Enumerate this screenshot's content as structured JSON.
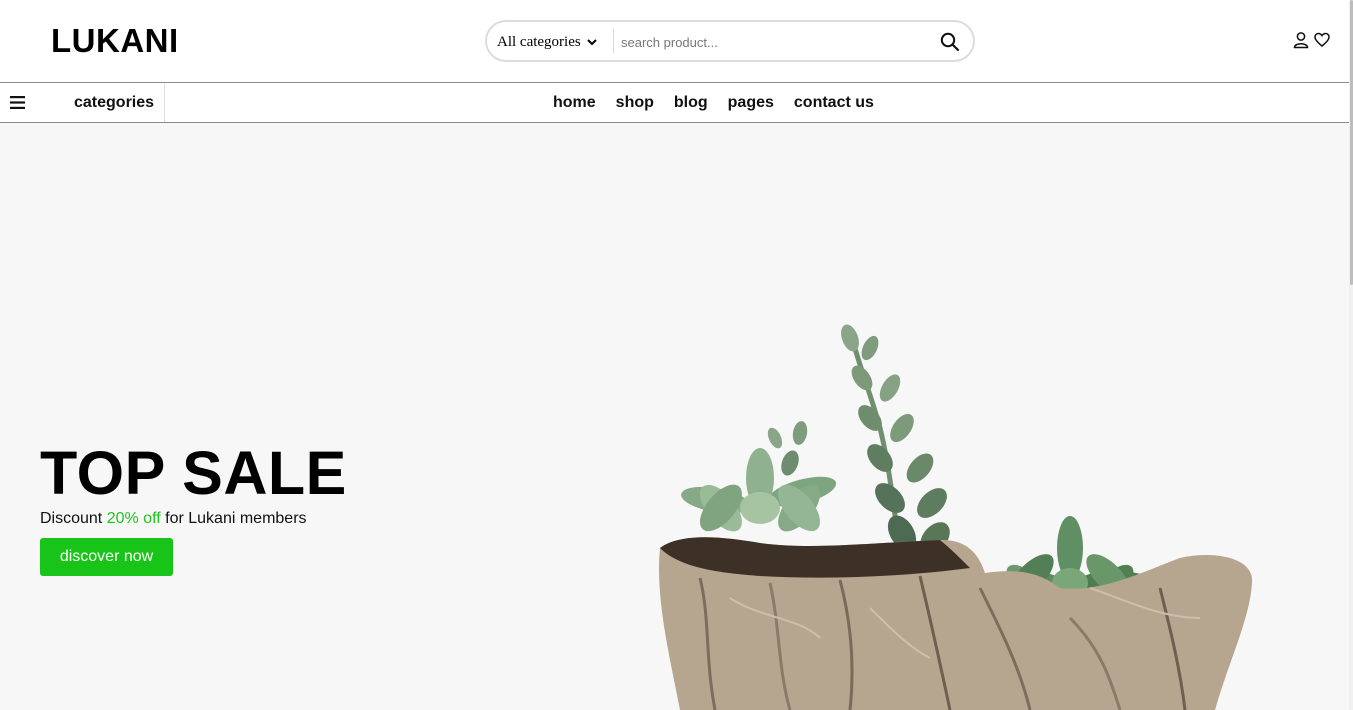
{
  "header": {
    "logo": "LUKANI",
    "search": {
      "category_selected": "All categories",
      "placeholder": "search product..."
    },
    "icons": [
      "user-icon",
      "heart-icon",
      "search-icon",
      "chevron-down-icon"
    ]
  },
  "navbar": {
    "categories_label": "categories",
    "links": [
      "home",
      "shop",
      "blog",
      "pages",
      "contact us"
    ]
  },
  "hero": {
    "title": "TOP SALE",
    "subtitle_prefix": "Discount",
    "subtitle_accent": "20% off",
    "subtitle_suffix": "for Lukani members",
    "button_label": "discover now"
  },
  "colors": {
    "accent": "#18c418",
    "hero_bg": "#f7f7f7",
    "text": "#111111"
  }
}
